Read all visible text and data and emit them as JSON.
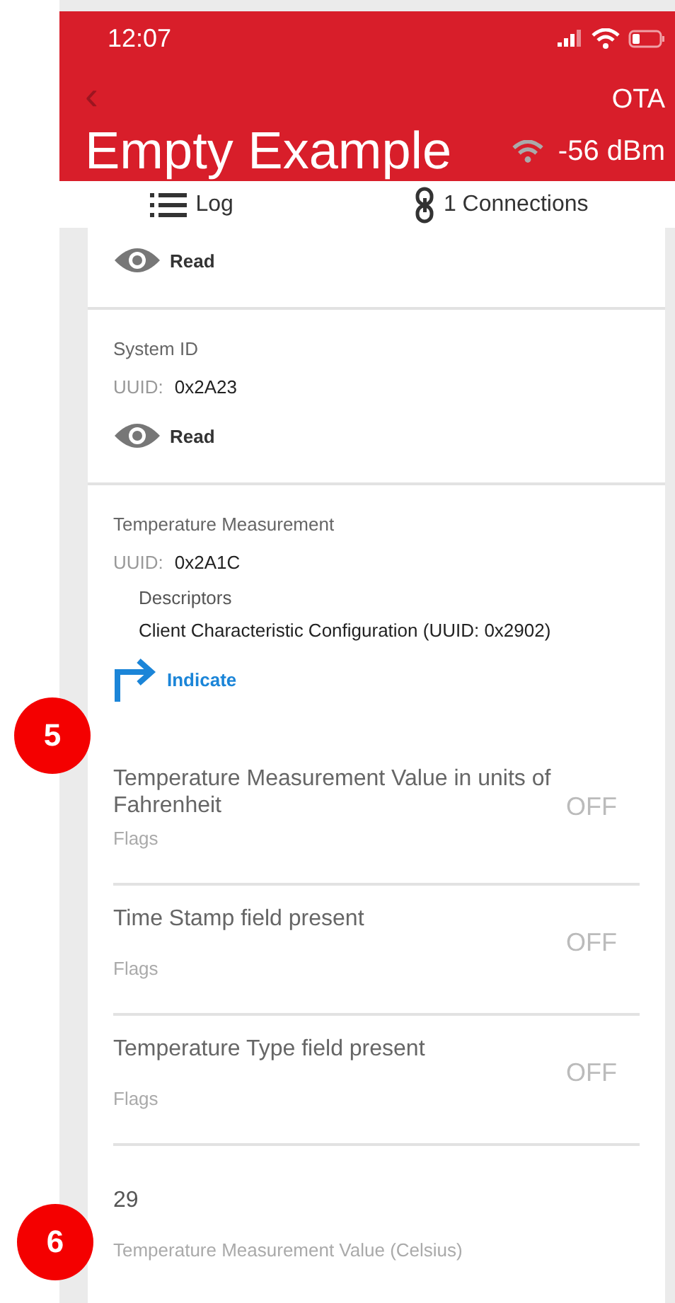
{
  "status_bar": {
    "time": "12:07"
  },
  "header": {
    "back": "‹",
    "action": "OTA",
    "title": "Empty Example",
    "rssi": "-56 dBm"
  },
  "tabs": [
    {
      "label": "Log",
      "kind": "log"
    },
    {
      "label": "1 Connections",
      "kind": "connections"
    }
  ],
  "characteristics": [
    {
      "kind": "partial",
      "actions": [
        {
          "kind": "read",
          "label": "Read"
        }
      ]
    },
    {
      "kind": "full",
      "name": "System ID",
      "uuid_label": "UUID:",
      "uuid": "0x2A23",
      "actions": [
        {
          "kind": "read",
          "label": "Read"
        }
      ]
    },
    {
      "kind": "full",
      "name": "Temperature Measurement",
      "uuid_label": "UUID:",
      "uuid": "0x2A1C",
      "descriptors_title": "Descriptors",
      "descriptors": [
        "Client Characteristic Configuration (UUID: 0x2902)"
      ],
      "actions": [
        {
          "kind": "indicate",
          "label": "Indicate"
        }
      ],
      "fields": [
        {
          "kind": "flag",
          "title": "Temperature Measurement Value in units of Fahrenheit",
          "caption": "Flags",
          "value": "OFF"
        },
        {
          "kind": "flag",
          "title": "Time Stamp field present",
          "caption": "Flags",
          "value": "OFF"
        },
        {
          "kind": "flag",
          "title": "Temperature Type field present",
          "caption": "Flags",
          "value": "OFF"
        },
        {
          "kind": "value",
          "value": "29",
          "caption": "Temperature Measurement Value (Celsius)"
        }
      ]
    }
  ],
  "callouts": [
    {
      "label": "5"
    },
    {
      "label": "6"
    }
  ]
}
